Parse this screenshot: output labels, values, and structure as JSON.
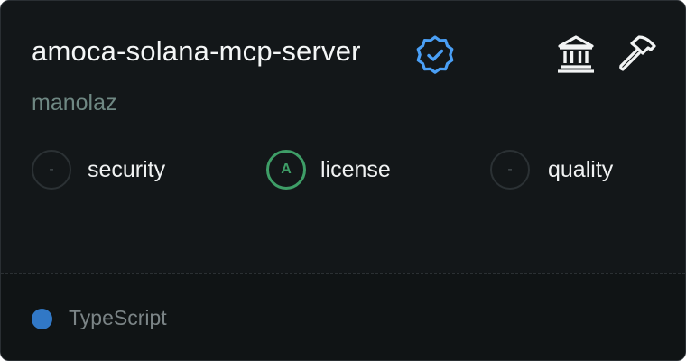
{
  "server": {
    "name": "amoca-solana-mcp-server",
    "author": "manolaz",
    "verified": true
  },
  "scores": [
    {
      "grade": "-",
      "label": "security",
      "status": "none"
    },
    {
      "grade": "A",
      "label": "license",
      "status": "good"
    },
    {
      "grade": "-",
      "label": "quality",
      "status": "none"
    }
  ],
  "language": {
    "name": "TypeScript",
    "color": "#3178c6"
  },
  "icons": {
    "verified": "verified-badge-icon",
    "bank": "bank-icon",
    "hammer": "hammer-icon"
  },
  "colors": {
    "background": "#131719",
    "verified_blue": "#4a9ff5",
    "grade_good": "#3e9e67"
  }
}
